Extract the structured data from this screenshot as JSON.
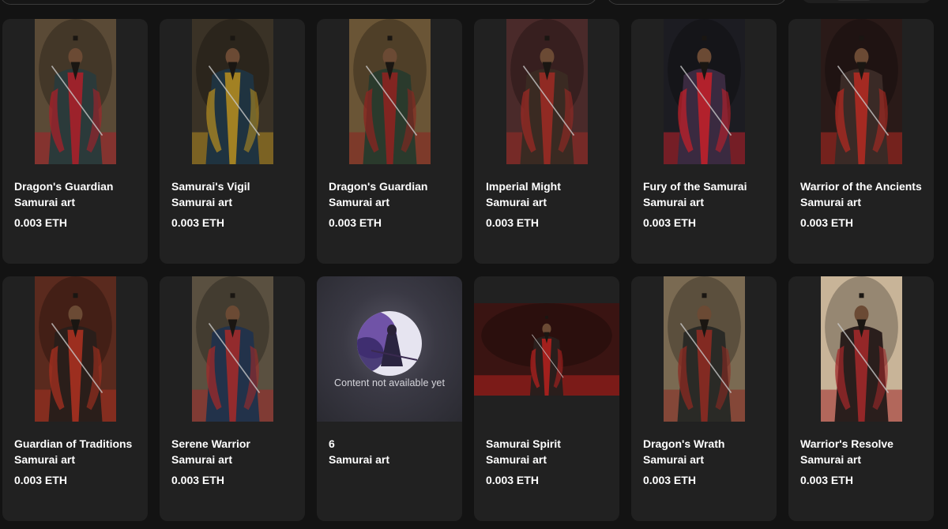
{
  "placeholder_text": "Content not available yet",
  "cards": [
    {
      "title": "Dragon's Guardian",
      "collection": "Samurai art",
      "price": "0.003 ETH",
      "bg": "#5a4a36",
      "robe": "#2b3a3a",
      "accent": "#a8202a"
    },
    {
      "title": "Samurai's Vigil",
      "collection": "Samurai art",
      "price": "0.003 ETH",
      "bg": "#3a3226",
      "robe": "#1f3340",
      "accent": "#b08a20"
    },
    {
      "title": "Dragon's Guardian",
      "collection": "Samurai art",
      "price": "0.003 ETH",
      "bg": "#6a5536",
      "robe": "#2a3a2c",
      "accent": "#8c2420"
    },
    {
      "title": "Imperial Might",
      "collection": "Samurai art",
      "price": "0.003 ETH",
      "bg": "#4a2a2a",
      "robe": "#3a2a22",
      "accent": "#9a2a24"
    },
    {
      "title": "Fury of the Samurai",
      "collection": "Samurai art",
      "price": "0.003 ETH",
      "bg": "#1c1c22",
      "robe": "#3a2a40",
      "accent": "#c0202a"
    },
    {
      "title": "Warrior of the Ancients",
      "collection": "Samurai art",
      "price": "0.003 ETH",
      "bg": "#2a1a18",
      "robe": "#3a2a26",
      "accent": "#b02a22"
    },
    {
      "title": "Guardian of Traditions",
      "collection": "Samurai art",
      "price": "0.003 ETH",
      "bg": "#5a2a1e",
      "robe": "#2a1e1a",
      "accent": "#a83020"
    },
    {
      "title": "Serene Warrior",
      "collection": "Samurai art",
      "price": "0.003 ETH",
      "bg": "#5a5040",
      "robe": "#22324a",
      "accent": "#a02a2a"
    },
    {
      "title": "6",
      "collection": "Samurai art",
      "price": "",
      "placeholder": true
    },
    {
      "title": "Samurai Spirit",
      "collection": "Samurai art",
      "price": "0.003 ETH",
      "bg": "#3a1412",
      "robe": "#2a1e1c",
      "accent": "#b0201e",
      "wide": true
    },
    {
      "title": "Dragon's Wrath",
      "collection": "Samurai art",
      "price": "0.003 ETH",
      "bg": "#7a6a52",
      "robe": "#2a2a26",
      "accent": "#8c2a22"
    },
    {
      "title": "Warrior's Resolve",
      "collection": "Samurai art",
      "price": "0.003 ETH",
      "bg": "#c8b498",
      "robe": "#2a1e1c",
      "accent": "#a0282a"
    }
  ]
}
